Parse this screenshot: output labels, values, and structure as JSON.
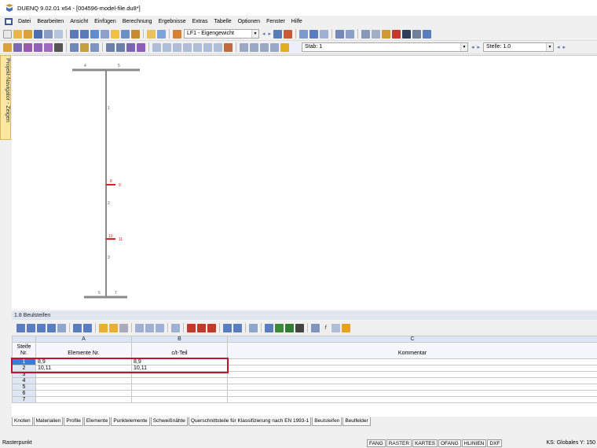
{
  "window": {
    "title": "DUENQ 9.02.01 x64 - [004596-model-file.du8*]"
  },
  "menu": [
    "Datei",
    "Bearbeiten",
    "Ansicht",
    "Einfügen",
    "Berechnung",
    "Ergebnisse",
    "Extras",
    "Tabelle",
    "Optionen",
    "Fenster",
    "Hilfe"
  ],
  "toolbar1": {
    "loadcase_value": "LF1 - Eigengewicht"
  },
  "toolbar2": {
    "member_value": "Stab: 1",
    "location_value": "Stelle: 1.0"
  },
  "navigator": {
    "label": "Projekt-Navigator - Zeigen"
  },
  "model": {
    "node_labels": [
      "4",
      "5",
      "1",
      "8",
      "9",
      "2",
      "10",
      "11",
      "3",
      "6",
      "7"
    ]
  },
  "panel": {
    "title": "1.8 Beulsteifen"
  },
  "table": {
    "col_letters": [
      "A",
      "B",
      "C"
    ],
    "rownum_header": [
      "Steife",
      "Nr."
    ],
    "headers": [
      "Elemente Nr.",
      "c/t-Teil",
      "Kommentar"
    ],
    "rows": [
      {
        "nr": "1",
        "elements": "8,9",
        "ct": "8,9",
        "comment": ""
      },
      {
        "nr": "2",
        "elements": "10,11",
        "ct": "10,11",
        "comment": ""
      },
      {
        "nr": "3",
        "elements": "",
        "ct": "",
        "comment": ""
      },
      {
        "nr": "4",
        "elements": "",
        "ct": "",
        "comment": ""
      },
      {
        "nr": "5",
        "elements": "",
        "ct": "",
        "comment": ""
      },
      {
        "nr": "6",
        "elements": "",
        "ct": "",
        "comment": ""
      },
      {
        "nr": "7",
        "elements": "",
        "ct": "",
        "comment": ""
      }
    ]
  },
  "sheet_tabs": [
    "Knoten",
    "Materialien",
    "Profile",
    "Elemente",
    "Punktelemente",
    "Schweißnähte",
    "Querschnittsteile für Klassifizierung nach EN 1993-1",
    "Beulsteifen",
    "Beulfelder"
  ],
  "active_tab": "Beulsteifen",
  "status": {
    "left": "Rasterpunkt",
    "buttons": [
      "FANG",
      "RASTER",
      "KARTES",
      "OFANG",
      "HLINIEN",
      "DXF"
    ],
    "right": "KS: Globales   Y: 150"
  },
  "colors": {
    "selection": "#3d7bd5",
    "highlight": "#c8102e",
    "header": "#dde7f3"
  }
}
